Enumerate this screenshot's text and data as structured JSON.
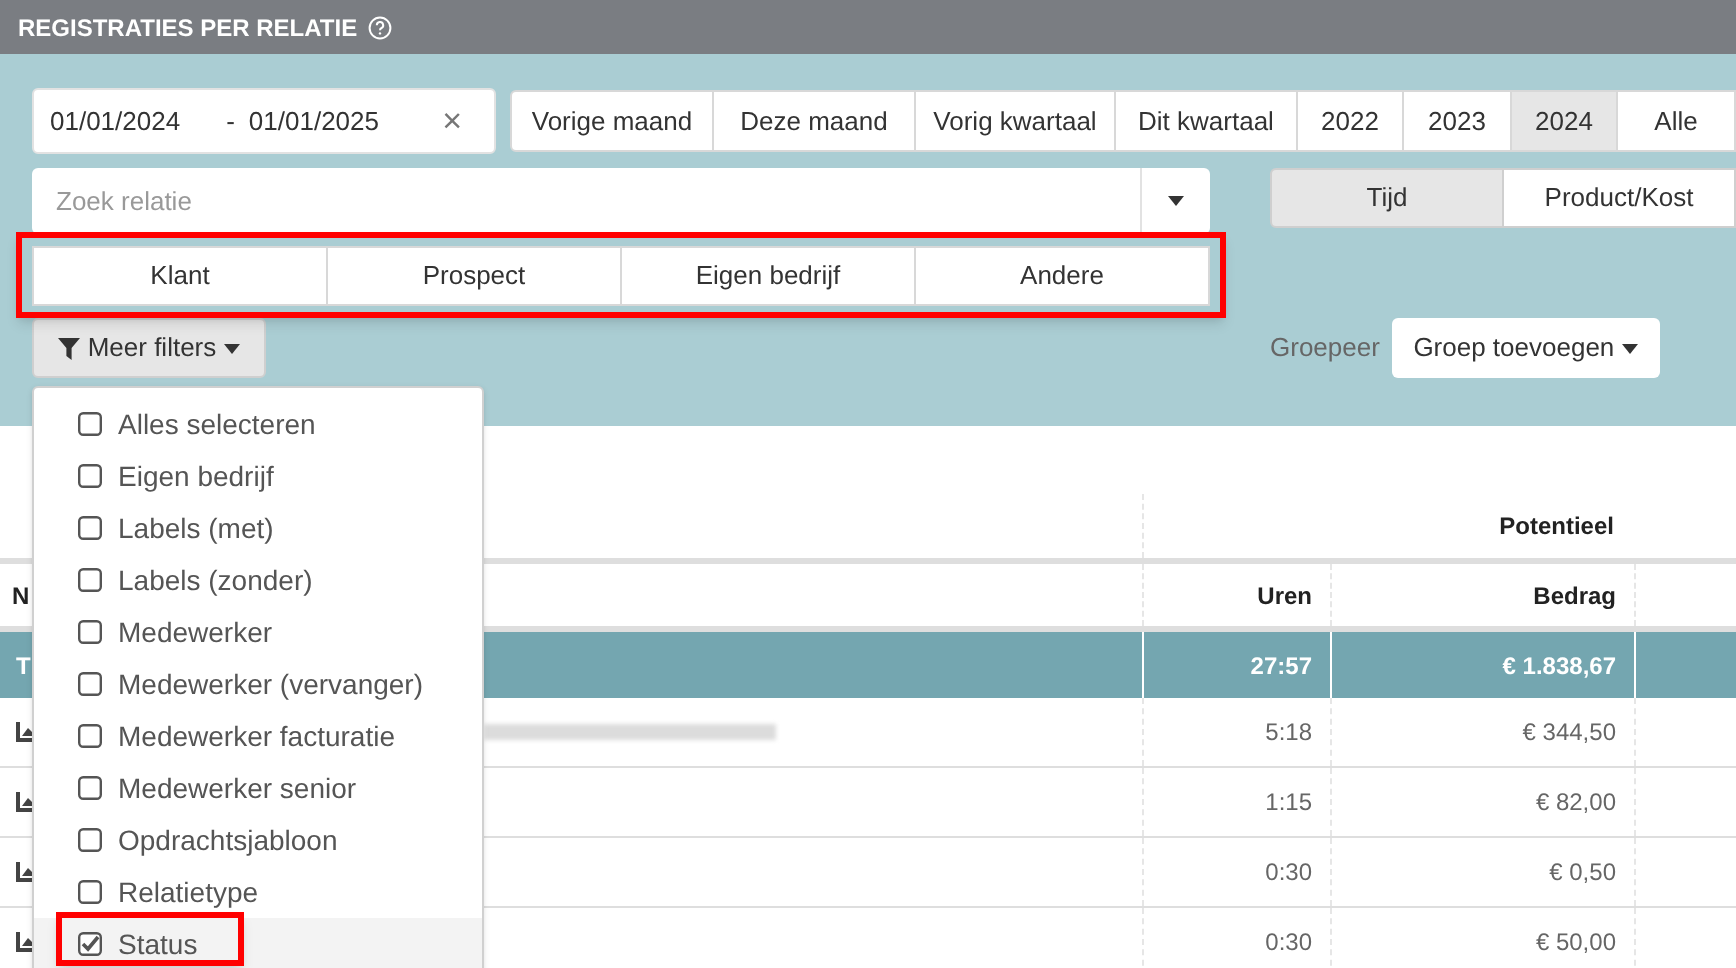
{
  "header": {
    "title": "REGISTRATIES PER RELATIE"
  },
  "date_range": {
    "from": "01/01/2024",
    "separator": "-",
    "to": "01/01/2025",
    "clear": "×"
  },
  "periods": [
    {
      "label": "Vorige maand",
      "selected": false
    },
    {
      "label": "Deze maand",
      "selected": false
    },
    {
      "label": "Vorig kwartaal",
      "selected": false
    },
    {
      "label": "Dit kwartaal",
      "selected": false
    },
    {
      "label": "2022",
      "selected": false
    },
    {
      "label": "2023",
      "selected": false
    },
    {
      "label": "2024",
      "selected": true
    },
    {
      "label": "Alle",
      "selected": false
    }
  ],
  "relation_search": {
    "placeholder": "Zoek relatie"
  },
  "view_toggle": [
    {
      "label": "Tijd",
      "selected": true
    },
    {
      "label": "Product/Kost",
      "selected": false
    }
  ],
  "relation_types": [
    "Klant",
    "Prospect",
    "Eigen bedrijf",
    "Andere"
  ],
  "more_filters": {
    "label": "Meer filters"
  },
  "group": {
    "label": "Groepeer",
    "button": "Groep toevoegen"
  },
  "filter_menu": [
    {
      "label": "Alles selecteren",
      "checked": false,
      "selected": false
    },
    {
      "label": "Eigen bedrijf",
      "checked": false,
      "selected": false
    },
    {
      "label": "Labels (met)",
      "checked": false,
      "selected": false
    },
    {
      "label": "Labels (zonder)",
      "checked": false,
      "selected": false
    },
    {
      "label": "Medewerker",
      "checked": false,
      "selected": false
    },
    {
      "label": "Medewerker (vervanger)",
      "checked": false,
      "selected": false
    },
    {
      "label": "Medewerker facturatie",
      "checked": false,
      "selected": false
    },
    {
      "label": "Medewerker senior",
      "checked": false,
      "selected": false
    },
    {
      "label": "Opdrachtsjabloon",
      "checked": false,
      "selected": false
    },
    {
      "label": "Relatietype",
      "checked": false,
      "selected": false
    },
    {
      "label": "Status",
      "checked": true,
      "selected": true
    }
  ],
  "table": {
    "group_header": "Potentieel",
    "columns": [
      "N",
      "Uren",
      "Bedrag"
    ],
    "total": {
      "label": "T",
      "uren": "27:57",
      "bedrag": "€ 1.838,67"
    },
    "rows": [
      {
        "uren": "5:18",
        "bedrag": "€ 344,50"
      },
      {
        "uren": "1:15",
        "bedrag": "€ 82,00"
      },
      {
        "uren": "0:30",
        "bedrag": "€ 0,50"
      },
      {
        "uren": "0:30",
        "bedrag": "€ 50,00"
      }
    ]
  }
}
